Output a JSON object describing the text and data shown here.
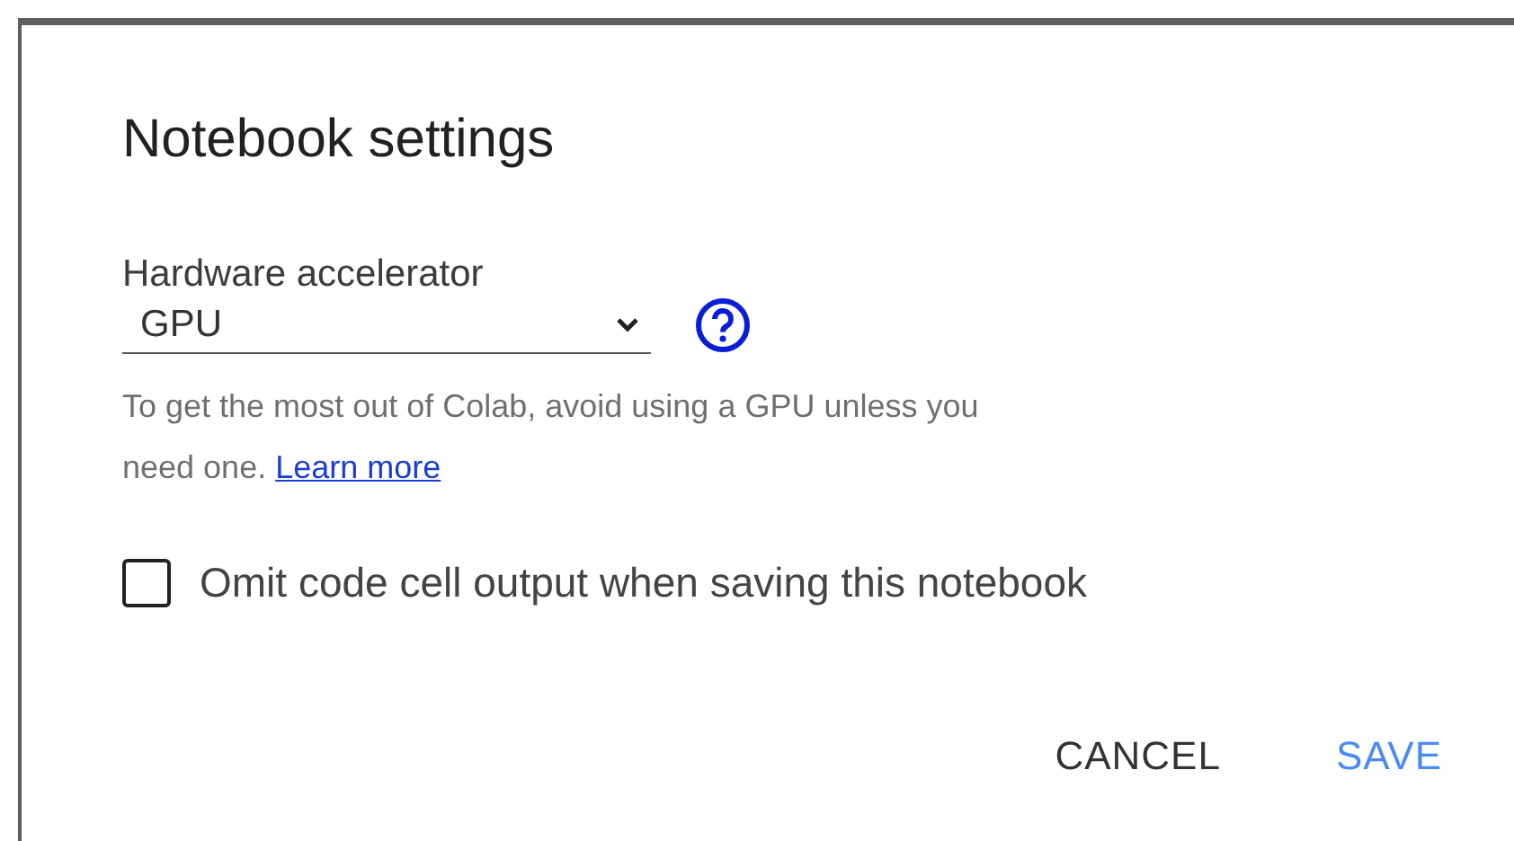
{
  "dialog": {
    "title": "Notebook settings",
    "accelerator": {
      "label": "Hardware accelerator",
      "value": "GPU"
    },
    "hint": {
      "text": "To get the most out of Colab, avoid using a GPU unless you need one.",
      "link": "Learn more"
    },
    "omit_output": {
      "label": "Omit code cell output when saving this notebook",
      "checked": false
    },
    "buttons": [
      {
        "label": "CANCEL",
        "kind": "secondary"
      },
      {
        "label": "SAVE",
        "kind": "primary"
      }
    ]
  }
}
